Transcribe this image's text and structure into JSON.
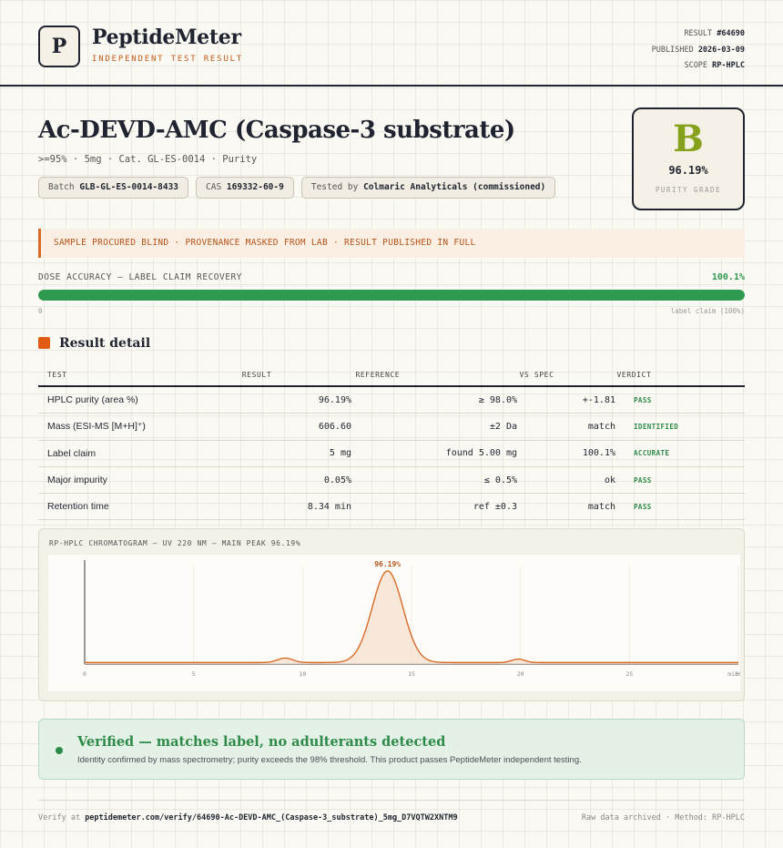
{
  "brand": {
    "logo_letter": "P",
    "name": "PeptideMeter",
    "tagline": "INDEPENDENT TEST RESULT"
  },
  "meta": {
    "result_label": "RESULT",
    "result_value": "#64690",
    "published_label": "PUBLISHED",
    "published_value": "2026-03-09",
    "scope_label": "SCOPE",
    "scope_value": "RP-HPLC"
  },
  "product": {
    "title": "Ac-DEVD-AMC (Caspase-3 substrate)",
    "subtitle": ">=95% · 5mg · Cat. GL-ES-0014 · Purity",
    "chips": [
      {
        "label": "Batch",
        "value": "GLB-GL-ES-0014-8433"
      },
      {
        "label": "CAS",
        "value": "169332-60-9"
      },
      {
        "label": "Tested by",
        "value": "Colmaric Analyticals (commissioned)"
      }
    ]
  },
  "grade": {
    "letter": "B",
    "value": "96.19%",
    "label": "PURITY GRADE",
    "color": "#86a21c"
  },
  "notice": "SAMPLE PROCURED BLIND · PROVENANCE MASKED FROM LAB · RESULT PUBLISHED IN FULL",
  "dose": {
    "label": "DOSE ACCURACY — LABEL CLAIM RECOVERY",
    "value_text": "100.1%",
    "fill_fraction": 1.0,
    "min_label": "0",
    "max_label": "label claim (100%)",
    "color": "#2e9a4f"
  },
  "detail": {
    "title": "Result detail",
    "headers": [
      "TEST",
      "RESULT",
      "REFERENCE",
      "VS SPEC",
      "VERDICT"
    ],
    "rows": [
      {
        "test": "HPLC purity (area %)",
        "result": "96.19%",
        "reference": "≥ 98.0%",
        "vs_spec": "+-1.81",
        "verdict": "PASS"
      },
      {
        "test": "Mass (ESI-MS [M+H]⁺)",
        "result": "606.60",
        "reference": "±2 Da",
        "vs_spec": "match",
        "verdict": "IDENTIFIED"
      },
      {
        "test": "Label claim",
        "result": "5 mg",
        "reference": "found 5.00 mg",
        "vs_spec": "100.1%",
        "verdict": "ACCURATE"
      },
      {
        "test": "Major impurity",
        "result": "0.05%",
        "reference": "≤ 0.5%",
        "vs_spec": "ok",
        "verdict": "PASS"
      },
      {
        "test": "Retention time",
        "result": "8.34 min",
        "reference": "ref ±0.3",
        "vs_spec": "match",
        "verdict": "PASS"
      }
    ]
  },
  "chart_data": {
    "type": "line",
    "title": "RP-HPLC CHROMATOGRAM — UV 220 NM — MAIN PEAK 96.19%",
    "x_ticks": [
      "0",
      "5",
      "10",
      "15",
      "20",
      "25",
      "30"
    ],
    "x_unit_label": "min",
    "xlim": [
      0,
      30
    ],
    "ylim": [
      0,
      100
    ],
    "baseline": 1.5,
    "peaks": [
      {
        "x": 9.2,
        "height": 4.5,
        "width": 0.35
      },
      {
        "x": 13.9,
        "height": 93,
        "width": 0.7,
        "label": "96.19%"
      },
      {
        "x": 19.9,
        "height": 3.5,
        "width": 0.3
      }
    ],
    "line_color": "#d96a28",
    "fill_color": "#f6e2d2"
  },
  "verified": {
    "title": "Verified — matches label, no adulterants detected",
    "text": "Identity confirmed by mass spectrometry; purity exceeds the 98% threshold. This product passes PeptideMeter independent testing."
  },
  "footer": {
    "verify_prefix": "Verify at",
    "verify_url": "peptidemeter.com/verify/64690-Ac-DEVD-AMC_(Caspase-3_substrate)_5mg_D7VQTW2XNTM9",
    "right_text": "Raw data archived · Method: RP-HPLC"
  }
}
